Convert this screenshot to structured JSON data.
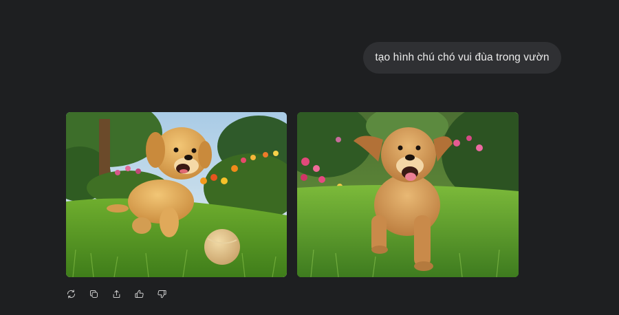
{
  "conversation": {
    "user_message": "tạo hình chú chó vui đùa trong vườn",
    "generated_images": [
      {
        "icon": "puppy-with-ball-image"
      },
      {
        "icon": "dog-running-in-garden-image"
      }
    ],
    "actions": [
      {
        "icon": "regenerate-icon"
      },
      {
        "icon": "copy-icon"
      },
      {
        "icon": "share-icon"
      },
      {
        "icon": "thumbs-up-icon"
      },
      {
        "icon": "thumbs-down-icon"
      }
    ]
  },
  "colors": {
    "background": "#1e1f21",
    "bubble": "#2f3033",
    "text": "#ececec",
    "icon": "#cfcfcf"
  }
}
